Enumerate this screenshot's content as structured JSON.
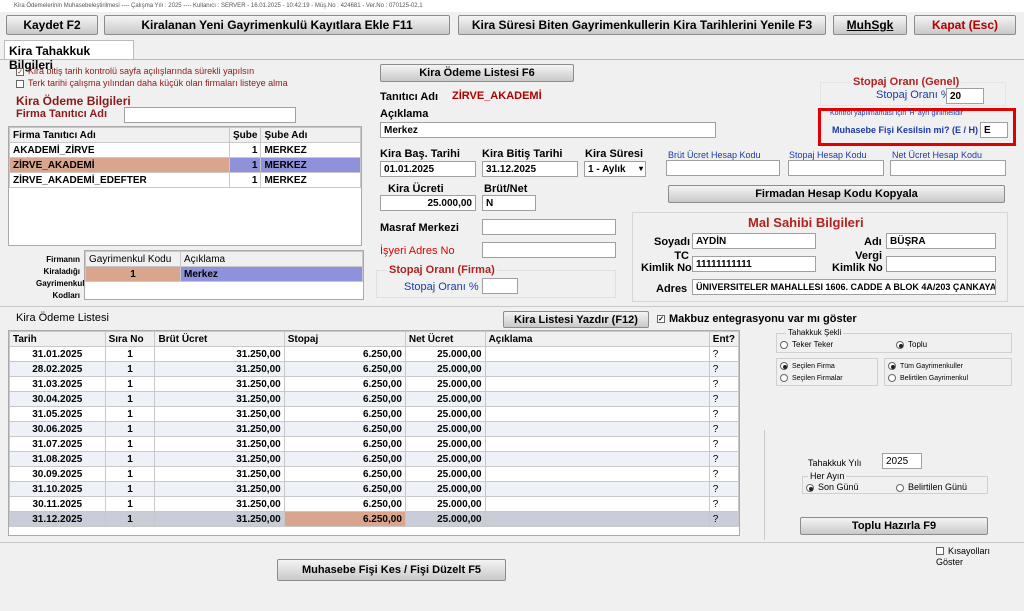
{
  "window_title": "Kira Ödemelerinin Muhasebeleştirilmesi ---- Çalışma Yılı : 2025 ---- Kullanıcı : SERVER - 16.01.2025 - 10:42:19 - Müş.No : 424681 - Ver.No : 070125-02.1",
  "toolbar": {
    "kaydet": "Kaydet F2",
    "ekle": "Kiralanan Yeni Gayrimenkulü Kayıtlara Ekle F11",
    "yenile": "Kira Süresi Biten Gayrimenkullerin Kira Tarihlerini Yenile F3",
    "muhsgk": "MuhSgk",
    "kapat": "Kapat (Esc)"
  },
  "tab": "Kira Tahakkuk Bilgileri",
  "options": {
    "opt1": "Kira bitiş tarih kontrolü sayfa açılışlarında sürekli yapılsın",
    "opt2": "Terk tarihi çalışma yılından daha küçük olan firmaları listeye alma"
  },
  "kira_odeme_bilgileri": "Kira Ödeme Bilgileri",
  "firma_tanitici_adi_label": "Firma Tanıtıcı Adı",
  "firma_grid": {
    "headers": [
      "Firma Tanıtıcı Adı",
      "Şube",
      "Şube Adı"
    ],
    "rows": [
      [
        "AKADEMİ_ZİRVE",
        "1",
        "MERKEZ"
      ],
      [
        "ZİRVE_AKADEMİ",
        "1",
        "MERKEZ"
      ],
      [
        "ZİRVE_AKADEMİ_EDEFTER",
        "1",
        "MERKEZ"
      ]
    ]
  },
  "firma_kiraladigi": {
    "label1": "Firmanın",
    "label2": "Kiraladığı",
    "label3": "Gayrimenkul",
    "label4": "Kodları",
    "headers": [
      "Gayrimenkul Kodu",
      "Açıklama"
    ],
    "rows": [
      [
        "1",
        "Merkez"
      ]
    ]
  },
  "kira_odeme_listesi_btn": "Kira Ödeme Listesi F6",
  "tanitici_adi_label": "Tanıtıcı Adı",
  "tanitici_adi_value": "ZİRVE_AKADEMİ",
  "aciklama_label": "Açıklama",
  "aciklama_value": "Merkez",
  "kira_bas_label": "Kira Baş. Tarihi",
  "kira_bas_value": "01.01.2025",
  "kira_bitis_label": "Kira Bitiş Tarihi",
  "kira_bitis_value": "31.12.2025",
  "kira_suresi_label": "Kira Süresi",
  "kira_suresi_value": "1 - Aylık",
  "kira_ucreti_label": "Kira Ücreti",
  "kira_ucreti_value": "25.000,00",
  "brut_net_label": "Brüt/Net",
  "brut_net_value": "N",
  "brut_ucret_hesap": "Brüt Ücret Hesap Kodu",
  "stopaj_hesap": "Stopaj Hesap Kodu",
  "net_ucret_hesap": "Net Ücret Hesap Kodu",
  "firmadan_kopyala": "Firmadan Hesap Kodu Kopyala",
  "stopaj_genel_title": "Stopaj Oranı (Genel)",
  "stopaj_orani_label": "Stopaj Oranı %",
  "stopaj_orani_value": "20",
  "kontrol_note": "Kontrol yapılmaması için 'H' ayrı girilmelidir",
  "muhasebe_fisi_label": "Muhasebe Fişi Kesilsin mi? (E / H)",
  "muhasebe_fisi_value": "E",
  "masraf_merkezi_label": "Masraf Merkezi",
  "isyeri_adres_label": "İşyeri Adres No",
  "stopaj_firma_title": "Stopaj Oranı (Firma)",
  "stopaj_firma_label": "Stopaj Oranı %",
  "mal_sahibi": {
    "title": "Mal Sahibi Bilgileri",
    "soyadi_label": "Soyadı",
    "soyadi_value": "AYDİN",
    "adi_label": "Adı",
    "adi_value": "BÜŞRA",
    "tc_label1": "TC",
    "tc_label2": "Kimlik No",
    "tc_value": "11111111111",
    "vergi_label1": "Vergi",
    "vergi_label2": "Kimlik No",
    "adres_label": "Adres",
    "adres_value": "ÜNIVERSITELER MAHALLESI 1606. CADDE A BLOK 4A/203 ÇANKAYA /"
  },
  "kira_odeme_listesi_title": "Kira Ödeme Listesi",
  "kira_listesi_yazdir": "Kira Listesi Yazdır (F12)",
  "makbuz_label": "Makbuz entegrasyonu var mı göster",
  "odeme_grid": {
    "headers": [
      "Tarih",
      "Sıra No",
      "Brüt Ücret",
      "Stopaj",
      "Net Ücret",
      "Açıklama",
      "Ent?"
    ],
    "rows": [
      [
        "31.01.2025",
        "1",
        "31.250,00",
        "6.250,00",
        "25.000,00",
        "",
        "?"
      ],
      [
        "28.02.2025",
        "1",
        "31.250,00",
        "6.250,00",
        "25.000,00",
        "",
        "?"
      ],
      [
        "31.03.2025",
        "1",
        "31.250,00",
        "6.250,00",
        "25.000,00",
        "",
        "?"
      ],
      [
        "30.04.2025",
        "1",
        "31.250,00",
        "6.250,00",
        "25.000,00",
        "",
        "?"
      ],
      [
        "31.05.2025",
        "1",
        "31.250,00",
        "6.250,00",
        "25.000,00",
        "",
        "?"
      ],
      [
        "30.06.2025",
        "1",
        "31.250,00",
        "6.250,00",
        "25.000,00",
        "",
        "?"
      ],
      [
        "31.07.2025",
        "1",
        "31.250,00",
        "6.250,00",
        "25.000,00",
        "",
        "?"
      ],
      [
        "31.08.2025",
        "1",
        "31.250,00",
        "6.250,00",
        "25.000,00",
        "",
        "?"
      ],
      [
        "30.09.2025",
        "1",
        "31.250,00",
        "6.250,00",
        "25.000,00",
        "",
        "?"
      ],
      [
        "31.10.2025",
        "1",
        "31.250,00",
        "6.250,00",
        "25.000,00",
        "",
        "?"
      ],
      [
        "30.11.2025",
        "1",
        "31.250,00",
        "6.250,00",
        "25.000,00",
        "",
        "?"
      ],
      [
        "31.12.2025",
        "1",
        "31.250,00",
        "6.250,00",
        "25.000,00",
        "",
        "?"
      ]
    ]
  },
  "tahakkuk_sekli": {
    "title": "Tahakkuk Şekli",
    "teker": "Teker Teker",
    "toplu": "Toplu",
    "secilen_firma": "Seçilen Firma",
    "secilen_firmalar": "Seçilen Firmalar",
    "tum_gayrimenkuller": "Tüm Gayrimenkuller",
    "belirtilen_gayrimenkul": "Belirtilen Gayrimenkul"
  },
  "tahakkuk_yili_label": "Tahakkuk Yılı",
  "tahakkuk_yili_value": "2025",
  "her_ayin": {
    "title": "Her Ayın",
    "son_gunu": "Son Günü",
    "belirtilen_gunu": "Belirtilen Günü"
  },
  "toplu_hazirla": "Toplu Hazırla F9",
  "kisayollari": "Kısayolları Göster",
  "muhasebe_fisi_kes": "Muhasebe Fişi Kes / Fişi Düzelt F5"
}
